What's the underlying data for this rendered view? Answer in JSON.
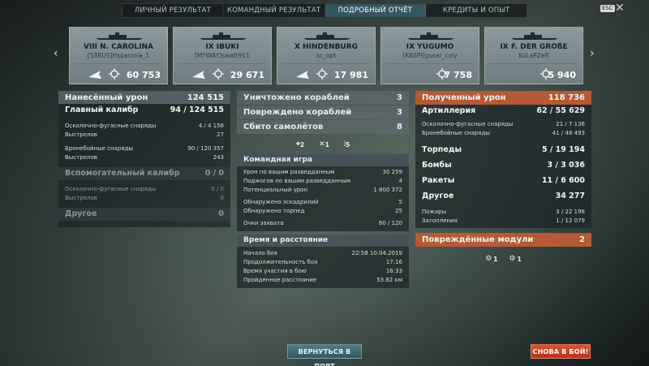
{
  "tabs": [
    "ЛИЧНЫЙ РЕЗУЛЬТАТ",
    "КОМАНДНЫЙ РЕЗУЛЬТАТ",
    "ПОДРОБНЫЙ ОТЧЁТ",
    "КРЕДИТЫ И ОПЫТ"
  ],
  "active_tab": 2,
  "esc": "ESC",
  "ships": [
    {
      "name": "VIII N. CAROLINA",
      "player": "[S8RUS]Hspaniola_1",
      "damage": "60 753",
      "ribbon": "plane-icon"
    },
    {
      "name": "IX IBUKI",
      "player": "[MYWAY]swatt911",
      "damage": "29 671",
      "ribbon": "plane-icon"
    },
    {
      "name": "X HINDENBURG",
      "player": "sc_opt",
      "damage": "17 981",
      "ribbon": "plane-icon"
    },
    {
      "name": "IX YUGUMO",
      "player": "[KASPI]gusar_coly",
      "damage": "7 758",
      "ribbon": ""
    },
    {
      "name": "IX F. DER GROßE",
      "player": "KoLaPZeR",
      "damage": "5 940",
      "ribbon": ""
    }
  ],
  "left": {
    "header_label": "Нанесённый урон",
    "header_value": "124 515",
    "main_label": "Главный калибр",
    "main_value": "94 / 124 515",
    "he_label": "Осколочно-фугасные снаряды",
    "he_value": "4 / 4 158",
    "he_shots_label": "Выстрелов",
    "he_shots": "27",
    "ap_label": "Бронебойные снаряды",
    "ap_value": "90 / 120 357",
    "ap_shots_label": "Выстрелов",
    "ap_shots": "243",
    "sec_label": "Вспомогательный калибр",
    "sec_value": "0 / 0",
    "sec_he_label": "Осколочно-фугасные снаряды",
    "sec_he_value": "0 / 0",
    "sec_shots_label": "Выстрелов",
    "sec_shots": "0",
    "other_label": "Другое",
    "other_value": "0"
  },
  "middle": {
    "destroyed_label": "Уничтожено кораблей",
    "destroyed": "3",
    "damaged_label": "Повреждено кораблей",
    "damaged": "3",
    "planes_label": "Сбито самолётов",
    "planes": "8",
    "icons": [
      {
        "name": "crosshair-icon",
        "value": "2"
      },
      {
        "name": "cross-icon",
        "value": "1"
      },
      {
        "name": "flames-icon",
        "value": "5"
      }
    ],
    "team_header": "Командная игра",
    "team_rows": [
      {
        "label": "Урон по вашим разведданным",
        "value": "30 259"
      },
      {
        "label": "Поджогов по вашим разведданным",
        "value": "4"
      },
      {
        "label": "Потенциальный урон",
        "value": "1 800 372"
      },
      {
        "label": "Обнаружено эскадрилий",
        "value": "5"
      },
      {
        "label": "Обнаружено торпед",
        "value": "25"
      },
      {
        "label": "Очки захвата",
        "value": "60 / 120"
      }
    ],
    "time_header": "Время и расстояние",
    "time_rows": [
      {
        "label": "Начало боя",
        "value": "22:58  10.04.2019"
      },
      {
        "label": "Продолжительность боя",
        "value": "17:16"
      },
      {
        "label": "Время участия в бою",
        "value": "16:33"
      },
      {
        "label": "Пройденное расстояние",
        "value": "53.82 км"
      }
    ]
  },
  "right": {
    "header_label": "Полученный урон",
    "header_value": "118 736",
    "art_label": "Артиллерия",
    "art_value": "62 / 55 629",
    "he_label": "Осколочно-фугасные снаряды",
    "he_value": "21 / 7 136",
    "ap_label": "Бронебойные снаряды",
    "ap_value": "41 / 48 493",
    "torp_label": "Торпеды",
    "torp_value": "5 / 19 194",
    "bomb_label": "Бомбы",
    "bomb_value": "3 / 3 036",
    "rocket_label": "Ракеты",
    "rocket_value": "11 / 6 600",
    "other_label": "Другое",
    "other_value": "34 277",
    "fire_label": "Пожары",
    "fire_value": "3 / 22 198",
    "flood_label": "Затопления",
    "flood_value": "1 / 12 079",
    "modules_label": "Повреждённые модули",
    "modules_value": "2",
    "module_icons": [
      {
        "name": "rudder-icon",
        "value": "1"
      },
      {
        "name": "engine-icon",
        "value": "1"
      }
    ]
  },
  "buttons": {
    "port": "ВЕРНУТЬСЯ В ПОРТ",
    "battle": "СНОВА В БОЙ!"
  },
  "colors": {
    "accent": "#b55a34",
    "battle_button": "#d2432a",
    "active_tab": "#4f96aa"
  }
}
